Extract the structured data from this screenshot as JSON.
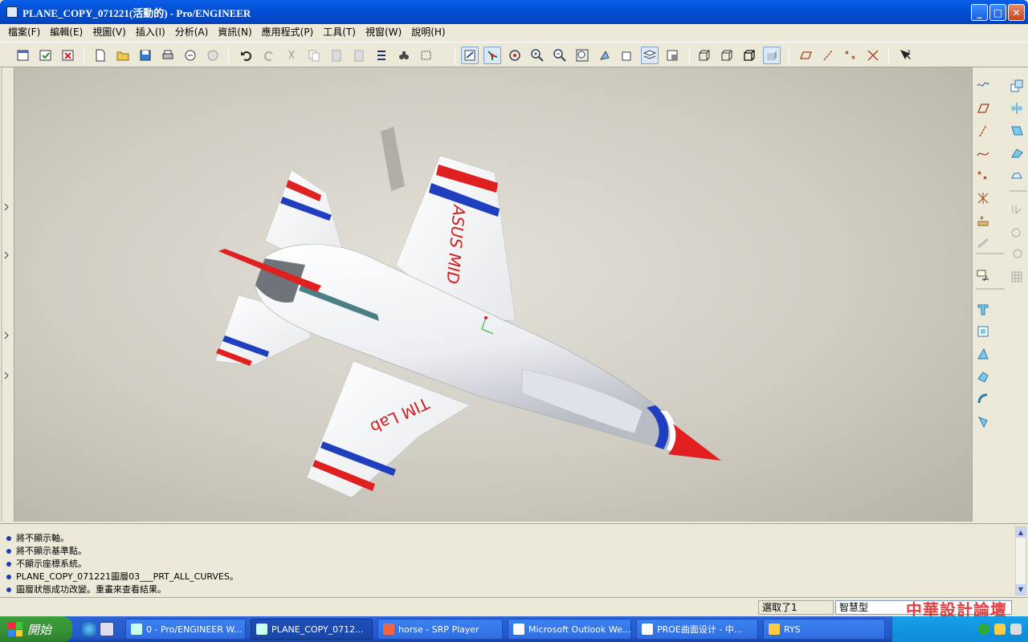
{
  "window": {
    "title": "PLANE_COPY_071221(活動的) - Pro/ENGINEER",
    "minimize_icon": "minimize-icon",
    "maximize_icon": "maximize-icon",
    "close_icon": "close-icon"
  },
  "menu": [
    "檔案(F)",
    "編輯(E)",
    "視圖(V)",
    "插入(I)",
    "分析(A)",
    "資訊(N)",
    "應用程式(P)",
    "工具(T)",
    "視窗(W)",
    "說明(H)"
  ],
  "model_labels": {
    "wing_top": "ASUS MID",
    "wing_bottom": "TIM Lab"
  },
  "messages": [
    "將不顯示軸。",
    "將不顯示基準點。",
    "不顯示座標系統。",
    "PLANE_COPY_071221圖層03___PRT_ALL_CURVES。",
    "圖層狀態成功改變。重畫來查看結果。"
  ],
  "status": {
    "selected": "選取了1",
    "filter": "智慧型"
  },
  "watermark": "中華設計論壇",
  "taskbar": {
    "start_label": "開始",
    "tasks": [
      "0 - Pro/ENGINEER W...",
      "PLANE_COPY_0712...",
      "horse - SRP Player",
      "Microsoft Outlook We...",
      "PROE曲面设计 - 中...",
      "RYS"
    ]
  },
  "colors": {
    "accent_red": "#e02020",
    "accent_blue": "#1f3fbf",
    "title_blue": "#0351d6"
  }
}
